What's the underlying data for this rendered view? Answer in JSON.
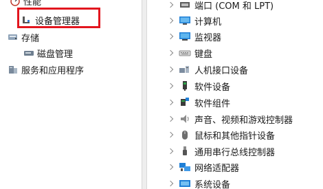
{
  "left_tree": {
    "performance_label": "性能",
    "device_manager_label": "设备管理器",
    "storage_label": "存储",
    "disk_management_label": "磁盘管理",
    "services_label": "服务和应用程序"
  },
  "devices": [
    {
      "label": "端口 (COM 和 LPT)",
      "icon": "port-icon"
    },
    {
      "label": "计算机",
      "icon": "computer-icon"
    },
    {
      "label": "监视器",
      "icon": "monitor-icon"
    },
    {
      "label": "键盘",
      "icon": "keyboard-icon"
    },
    {
      "label": "人机接口设备",
      "icon": "hid-icon"
    },
    {
      "label": "软件设备",
      "icon": "software-device-icon"
    },
    {
      "label": "软件组件",
      "icon": "software-component-icon"
    },
    {
      "label": "声音、视频和游戏控制器",
      "icon": "sound-icon"
    },
    {
      "label": "鼠标和其他指针设备",
      "icon": "mouse-icon"
    },
    {
      "label": "通用串行总线控制器",
      "icon": "usb-icon"
    },
    {
      "label": "网络适配器",
      "icon": "network-icon"
    },
    {
      "label": "系统设备",
      "icon": "system-icon"
    }
  ],
  "colors": {
    "highlight": "#e2151e",
    "accent": "#1f7fd6"
  }
}
